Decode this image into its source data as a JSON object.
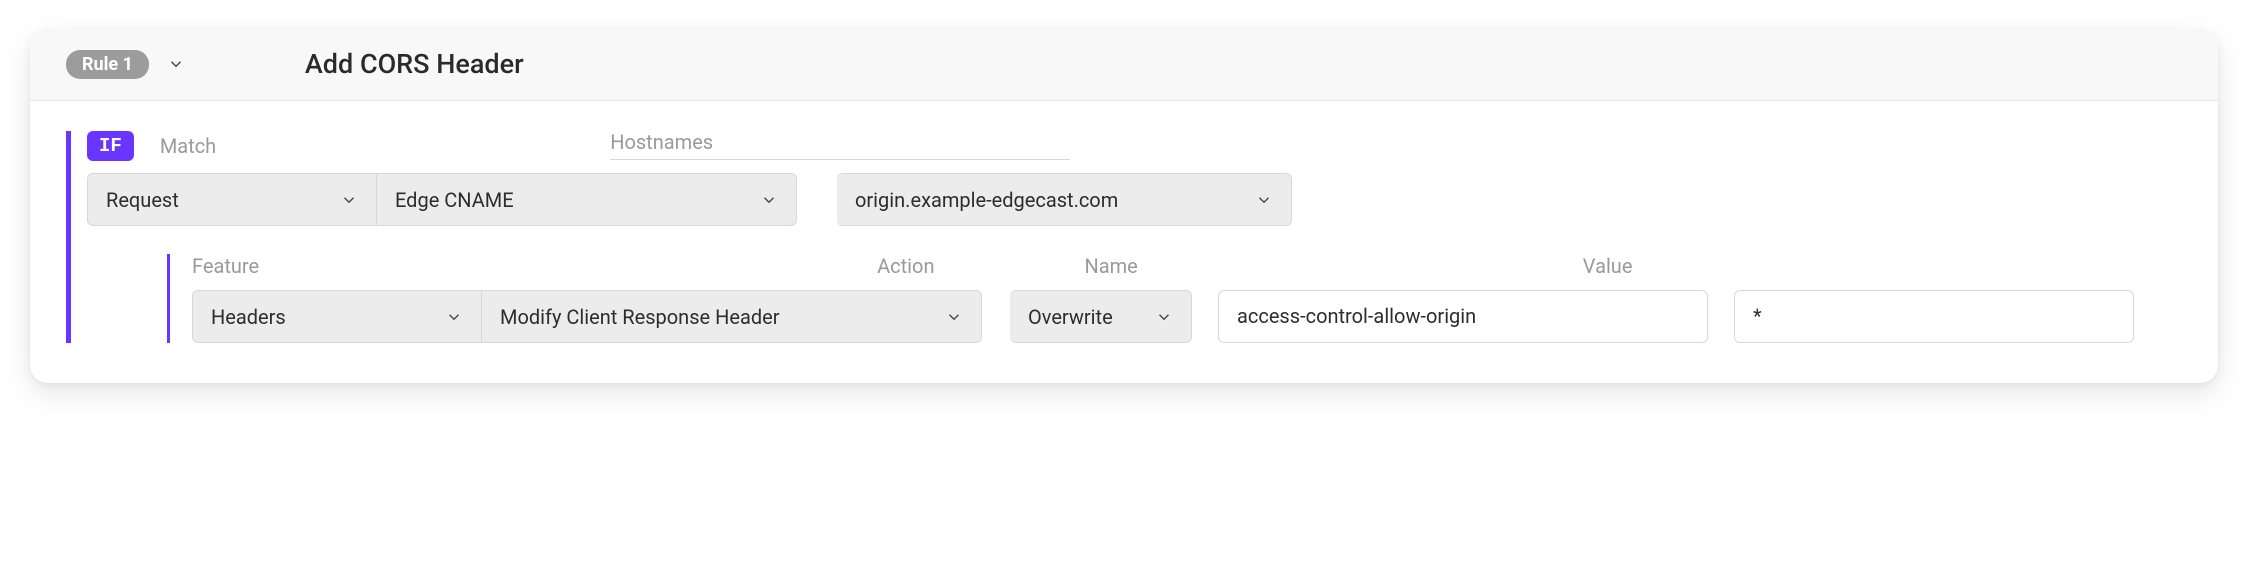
{
  "header": {
    "rule_badge": "Rule 1",
    "title": "Add CORS Header"
  },
  "if": {
    "badge": "IF",
    "labels": {
      "match": "Match",
      "hostnames": "Hostnames"
    },
    "match_type": "Request",
    "match_target": "Edge CNAME",
    "hostname": "origin.example-edgecast.com"
  },
  "feature": {
    "labels": {
      "feature": "Feature",
      "action": "Action",
      "name": "Name",
      "value": "Value"
    },
    "category": "Headers",
    "operation": "Modify Client Response Header",
    "action": "Overwrite",
    "name": "access-control-allow-origin",
    "value": "*"
  }
}
